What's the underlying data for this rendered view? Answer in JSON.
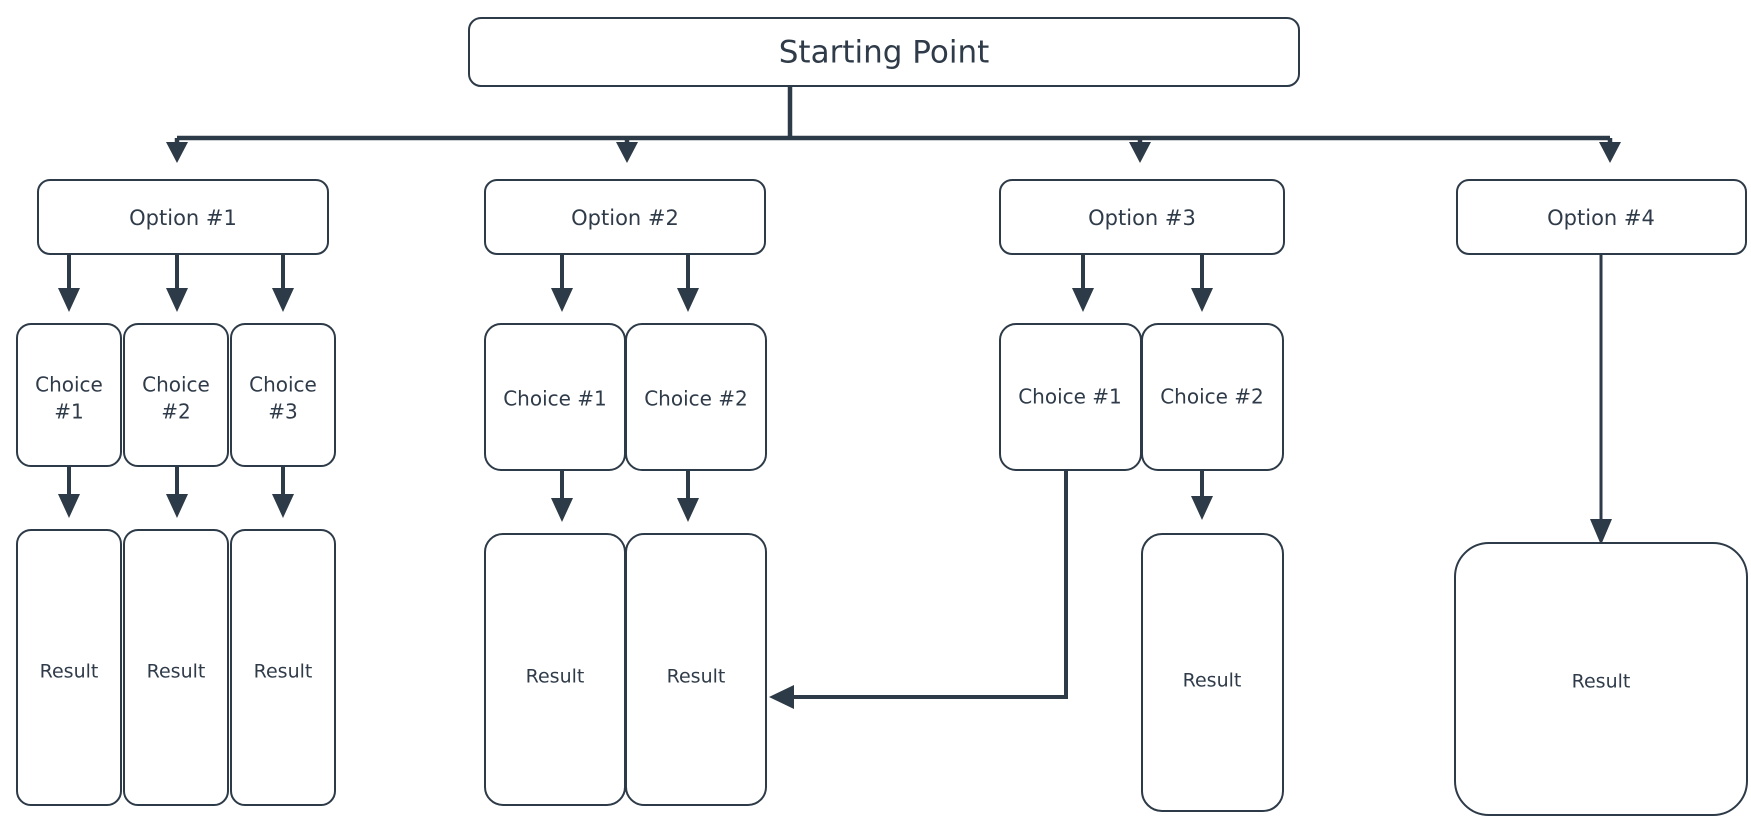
{
  "diagram": {
    "type": "flowchart",
    "title_node": {
      "label": "Starting Point"
    },
    "colors": {
      "node_border": "#2d3a47",
      "node_fill": "#ffffff",
      "edge": "#2d3a47",
      "text": "#2f3b49",
      "background": "#ffffff"
    },
    "branches": [
      {
        "option": {
          "label": "Option #1"
        },
        "choices": [
          {
            "line1": "Choice",
            "line2": "#1"
          },
          {
            "line1": "Choice",
            "line2": "#2"
          },
          {
            "line1": "Choice",
            "line2": "#3"
          }
        ],
        "results": [
          {
            "label": "Result"
          },
          {
            "label": "Result"
          },
          {
            "label": "Result"
          }
        ]
      },
      {
        "option": {
          "label": "Option #2"
        },
        "choices": [
          {
            "line1": "Choice #1",
            "line2": ""
          },
          {
            "line1": "Choice #2",
            "line2": ""
          }
        ],
        "results": [
          {
            "label": "Result"
          },
          {
            "label": "Result"
          }
        ]
      },
      {
        "option": {
          "label": "Option #3"
        },
        "choices": [
          {
            "line1": "Choice #1",
            "line2": ""
          },
          {
            "line1": "Choice #2",
            "line2": ""
          }
        ],
        "results": [
          {
            "label": "Result"
          }
        ]
      },
      {
        "option": {
          "label": "Option #4"
        },
        "choices": [],
        "results": [
          {
            "label": "Result"
          }
        ]
      }
    ]
  }
}
